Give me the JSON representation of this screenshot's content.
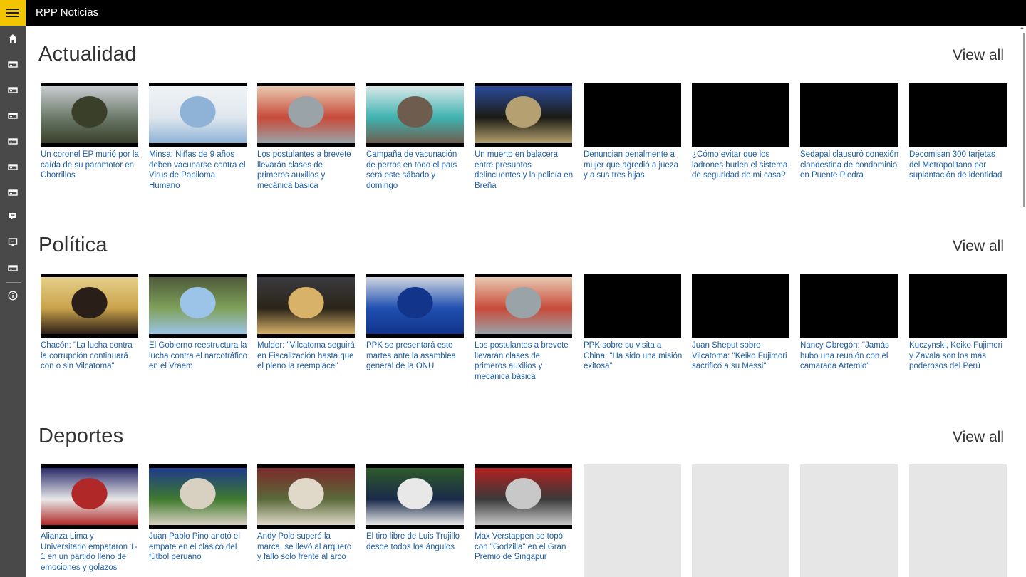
{
  "app": {
    "title": "RPP Noticias"
  },
  "sidebar": {
    "icons": [
      "home-icon",
      "news-icon",
      "news-icon",
      "news-icon",
      "news-icon",
      "news-icon",
      "news-icon",
      "chat-icon",
      "monitor-icon",
      "news-icon",
      "info-icon"
    ]
  },
  "sections": [
    {
      "title": "Actualidad",
      "view_all": "View all",
      "items": [
        {
          "caption": "Un coronel EP murió por la caída de su paramotor en Chorrillos",
          "image": "photo",
          "colors": [
            "#6b7a6a",
            "#3a3f2a",
            "#c9cdd0"
          ]
        },
        {
          "caption": "Minsa: Niñas de 9 años deben vacunarse contra el Virus de Papiloma Humano",
          "image": "photo",
          "colors": [
            "#dfe7ee",
            "#8fb3d6",
            "#f0f3f5"
          ]
        },
        {
          "caption": "Los postulantes a brevete llevarán clases de primeros auxilios y mecánica básica",
          "image": "photo",
          "colors": [
            "#c84b3a",
            "#9aa3a8",
            "#e8c9b0"
          ]
        },
        {
          "caption": "Campaña de vacunación de perros en todo el país será este sábado y domingo",
          "image": "photo",
          "colors": [
            "#3fb3b0",
            "#6e5d4e",
            "#d9e8ea"
          ]
        },
        {
          "caption": "Un muerto en balacera entre presuntos delincuentes y la policía en Breña",
          "image": "photo",
          "colors": [
            "#1c1c14",
            "#b4a070",
            "#2a4a9a"
          ]
        },
        {
          "caption": "Denuncian penalmente a mujer que agredió a jueza y a sus tres hijas",
          "image": "blank"
        },
        {
          "caption": "¿Cómo evitar que los ladrones burlen el sistema de seguridad de mi casa?",
          "image": "blank"
        },
        {
          "caption": "Sedapal clausuró conexión clandestina de condominio en Puente Piedra",
          "image": "blank"
        },
        {
          "caption": "Decomisan 300 tarjetas del Metropolitano por suplantación de identidad",
          "image": "blank"
        }
      ]
    },
    {
      "title": "Política",
      "view_all": "View all",
      "items": [
        {
          "caption": "Chacón: \"La lucha contra la corrupción continuará con o sin Vilcatoma\"",
          "image": "photo",
          "colors": [
            "#c9a24a",
            "#2a1e18",
            "#e5d08a"
          ]
        },
        {
          "caption": "El Gobierno reestructura la lucha contra el narcotráfico en el Vraem",
          "image": "photo",
          "colors": [
            "#7fa15a",
            "#9cc4e8",
            "#4e5a3a"
          ]
        },
        {
          "caption": "Mulder: \"Vilcatoma seguirá en Fiscalización hasta que el pleno la reemplace\"",
          "image": "photo",
          "colors": [
            "#2a2418",
            "#d9b26a",
            "#3a3a40"
          ]
        },
        {
          "caption": "PPK se presentará este martes ante la asamblea general de la ONU",
          "image": "photo",
          "colors": [
            "#1f4fb0",
            "#12348a",
            "#cfd6e0"
          ]
        },
        {
          "caption": "Los postulantes a brevete llevarán clases de primeros auxilios y mecánica básica",
          "image": "photo",
          "colors": [
            "#c84b3a",
            "#9aa3a8",
            "#e8c9b0"
          ]
        },
        {
          "caption": "PPK sobre su visita a China: \"Ha sido una misión exitosa\"",
          "image": "blank"
        },
        {
          "caption": "Juan Sheput sobre Vilcatoma: \"Keiko Fujimori sacrificó a su Messi\"",
          "image": "blank"
        },
        {
          "caption": "Nancy Obregón: \"Jamás hubo una reunión con el camarada Artemio\"",
          "image": "blank"
        },
        {
          "caption": "Kuczynski, Keiko Fujimori y Zavala son los más poderosos del Perú",
          "image": "blank"
        }
      ]
    },
    {
      "title": "Deportes",
      "view_all": "View all",
      "items": [
        {
          "caption": "Alianza Lima y Universitario empataron 1-1 en un partido lleno de emociones y golazos",
          "image": "photo",
          "colors": [
            "#e8e8e8",
            "#b02828",
            "#2a2a6a"
          ]
        },
        {
          "caption": "Juan Pablo Pino anotó el empate en el clásico del fútbol peruano",
          "image": "photo",
          "colors": [
            "#3f7a2e",
            "#d8d0c0",
            "#1f3a8a"
          ]
        },
        {
          "caption": "Andy Polo superó la marca, se llevó al arquero y falló solo frente al arco",
          "image": "photo",
          "colors": [
            "#5a6a3a",
            "#e0d8c8",
            "#7a2a2a"
          ]
        },
        {
          "caption": "El tiro libre de Luis Trujillo desde todos los ángulos",
          "image": "photo",
          "colors": [
            "#1a2a4a",
            "#e8e8e8",
            "#2e5a2a"
          ]
        },
        {
          "caption": "Max Verstappen se topó con \"Godzilla\" en el Gran Premio de Singapur",
          "image": "photo",
          "colors": [
            "#3a3a3a",
            "#c8c8c8",
            "#b02020"
          ]
        },
        {
          "caption": "",
          "image": "placeholder"
        },
        {
          "caption": "",
          "image": "placeholder"
        },
        {
          "caption": "",
          "image": "placeholder"
        },
        {
          "caption": "",
          "image": "placeholder"
        }
      ]
    }
  ]
}
